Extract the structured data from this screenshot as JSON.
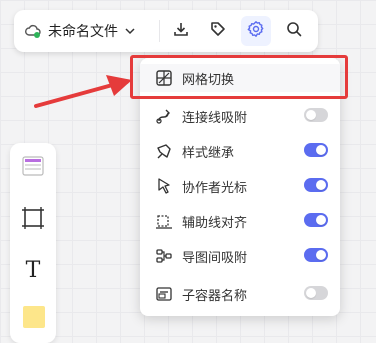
{
  "toolbar": {
    "file_name": "未命名文件",
    "buttons": [
      {
        "icon": "download-icon"
      },
      {
        "icon": "tag-icon"
      },
      {
        "icon": "settings-gear-icon"
      },
      {
        "icon": "search-icon"
      }
    ]
  },
  "settings_menu": {
    "items": [
      {
        "label": "网格切换",
        "icon": "grid-toggle-icon",
        "has_toggle": false
      },
      {
        "label": "连接线吸附",
        "icon": "connector-snap-icon",
        "has_toggle": true,
        "enabled": false
      },
      {
        "label": "样式继承",
        "icon": "style-inherit-icon",
        "has_toggle": true,
        "enabled": true
      },
      {
        "label": "协作者光标",
        "icon": "collaborator-cursor-icon",
        "has_toggle": true,
        "enabled": true
      },
      {
        "label": "辅助线对齐",
        "icon": "guide-align-icon",
        "has_toggle": true,
        "enabled": true
      },
      {
        "label": "导图间吸附",
        "icon": "mindmap-snap-icon",
        "has_toggle": true,
        "enabled": true
      },
      {
        "label": "子容器名称",
        "icon": "subcontainer-name-icon",
        "has_toggle": true,
        "enabled": false
      }
    ]
  },
  "left_toolbox": {
    "tools": [
      {
        "icon": "template-icon"
      },
      {
        "icon": "frame-icon"
      },
      {
        "icon": "text-icon",
        "glyph": "T"
      },
      {
        "icon": "sticky-note-icon"
      }
    ]
  },
  "colors": {
    "accent": "#5b6cf0",
    "toggle_off": "#d6d6d9",
    "highlight": "#e53b3b",
    "arrow": "#e53b3b",
    "cloud_status": "#2fb35a"
  }
}
